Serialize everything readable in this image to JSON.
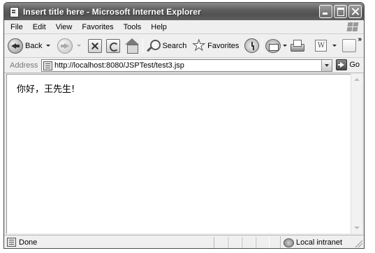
{
  "window": {
    "title": "Insert title here - Microsoft Internet Explorer"
  },
  "menu": {
    "items": [
      {
        "label": "File"
      },
      {
        "label": "Edit"
      },
      {
        "label": "View"
      },
      {
        "label": "Favorites"
      },
      {
        "label": "Tools"
      },
      {
        "label": "Help"
      }
    ]
  },
  "toolbar": {
    "back_label": "Back",
    "search_label": "Search",
    "favorites_label": "Favorites",
    "word_glyph": "W",
    "overflow_glyph": "»"
  },
  "address": {
    "label": "Address",
    "url": "http://localhost:8080/JSPTest/test3.jsp",
    "go_label": "Go"
  },
  "page": {
    "text": "你好，王先生!"
  },
  "status": {
    "text": "Done",
    "zone": "Local intranet"
  }
}
